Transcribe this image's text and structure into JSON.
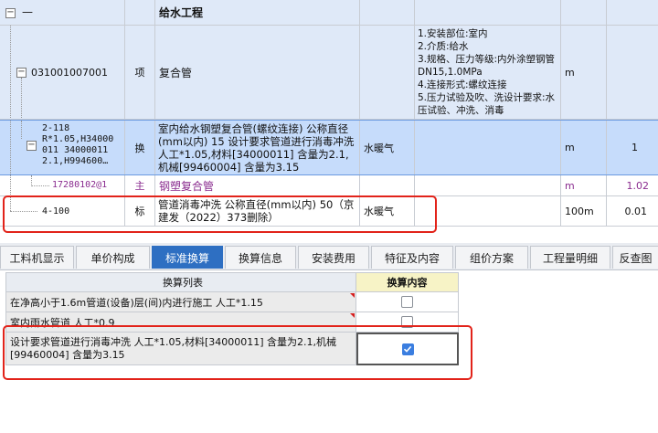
{
  "grid": {
    "header": {
      "expander": "−",
      "dash": "—",
      "title": "给水工程"
    },
    "list_item": {
      "code": "031001007001",
      "category": "项",
      "name": "复合管",
      "features": "1.安装部位:室内\n2.介质:给水\n3.规格、压力等级:内外涂塑钢管DN15,1.0MPa\n4.连接形式:螺纹连接\n5.压力试验及吹、洗设计要求:水压试验、冲洗、消毒",
      "unit": "m"
    },
    "sub_item": {
      "code": "2-118\nR*1.05,H34000\n011 34000011\n2.1,H994600…",
      "category": "换",
      "name": "室内给水钢塑复合管(螺纹连接) 公称直径(mm以内) 15  设计要求管道进行消毒冲洗 人工*1.05,材料[34000011] 含量为2.1,机械[99460004] 含量为3.15",
      "spec": "水暖气",
      "unit": "m",
      "qty": "1"
    },
    "main_material": {
      "code": "17280102@1",
      "category": "主",
      "name": "钢塑复合管",
      "unit": "m",
      "qty": "1.02"
    },
    "item_410": {
      "code": "4-100",
      "category": "标",
      "name": "管道消毒冲洗 公称直径(mm以内) 50（京建发（2022）373删除）",
      "spec": "水暖气",
      "unit": "100m",
      "qty": "0.01"
    }
  },
  "tabs": [
    {
      "label": "工料机显示",
      "active": false
    },
    {
      "label": "单价构成",
      "active": false
    },
    {
      "label": "标准换算",
      "active": true
    },
    {
      "label": "换算信息",
      "active": false
    },
    {
      "label": "安装费用",
      "active": false
    },
    {
      "label": "特征及内容",
      "active": false
    },
    {
      "label": "组价方案",
      "active": false
    },
    {
      "label": "工程量明细",
      "active": false
    },
    {
      "label": "反查图",
      "active": false
    }
  ],
  "panel": {
    "col_list": "换算列表",
    "col_content": "换算内容",
    "rows": [
      {
        "text": "在净高小于1.6m管道(设备)层(间)内进行施工 人工*1.15",
        "checked": false
      },
      {
        "text": "室内雨水管道 人工*0.9",
        "checked": false
      },
      {
        "text": "设计要求管道进行消毒冲洗 人工*1.05,材料[34000011] 含量为2.1,机械[99460004] 含量为3.15",
        "checked": true
      }
    ]
  },
  "colors": {
    "accent": "#2e6fc2",
    "highlight_row": "#c6dcfb",
    "annotation_red": "#e2231a",
    "main_material_text": "#8a2c8f"
  }
}
